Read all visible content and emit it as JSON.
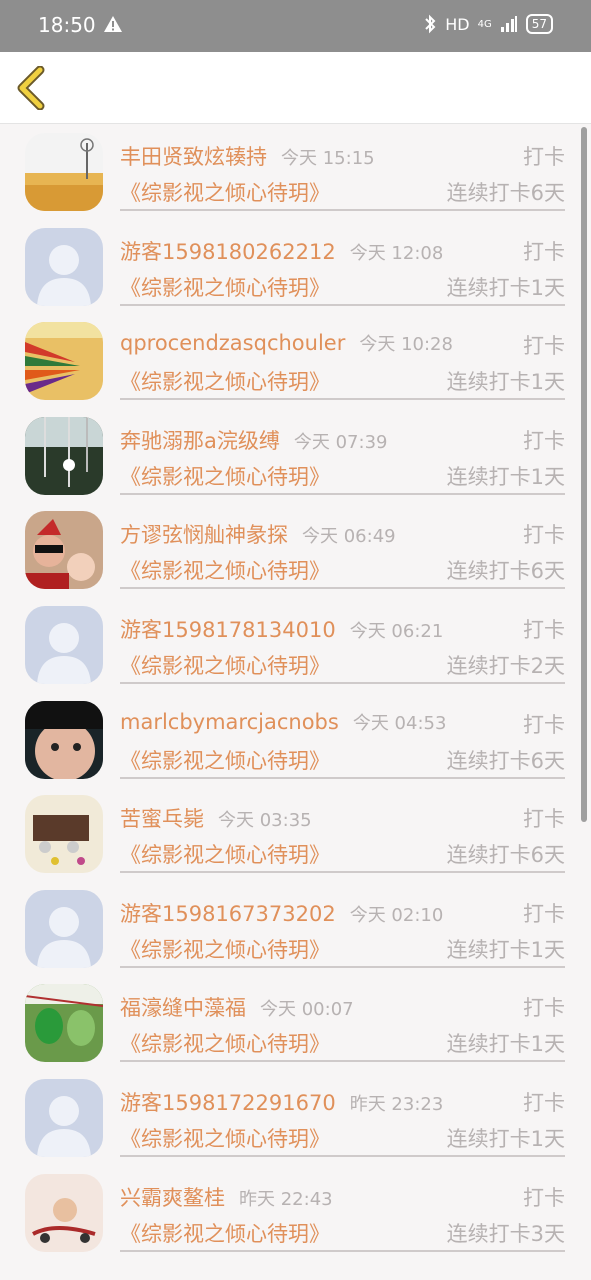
{
  "status_bar": {
    "time": "18:50",
    "network": "HD",
    "signal": "4G",
    "battery": "57"
  },
  "header": {
    "back_icon": "chevron-left-icon"
  },
  "list": [
    {
      "name": "丰田贤致炫辏持",
      "time": "今天 15:15",
      "action": "打卡",
      "book": "《综影视之倾心待玥》",
      "streak": "连续打卡6天",
      "avatar": "landscape"
    },
    {
      "name": "游客1598180262212",
      "time": "今天 12:08",
      "action": "打卡",
      "book": "《综影视之倾心待玥》",
      "streak": "连续打卡1天",
      "avatar": "default"
    },
    {
      "name": "qprocendzasqchouler",
      "time": "今天 10:28",
      "action": "打卡",
      "book": "《综影视之倾心待玥》",
      "streak": "连续打卡1天",
      "avatar": "pencils"
    },
    {
      "name": "奔驰溺那a浣级缚",
      "time": "今天 07:39",
      "action": "打卡",
      "book": "《综影视之倾心待玥》",
      "streak": "连续打卡1天",
      "avatar": "chimes"
    },
    {
      "name": "方谬弦悯舢神彖探",
      "time": "今天 06:49",
      "action": "打卡",
      "book": "《综影视之倾心待玥》",
      "streak": "连续打卡6天",
      "avatar": "family"
    },
    {
      "name": "游客1598178134010",
      "time": "今天 06:21",
      "action": "打卡",
      "book": "《综影视之倾心待玥》",
      "streak": "连续打卡2天",
      "avatar": "default"
    },
    {
      "name": "marlcbymarcjacnobs",
      "time": "今天 04:53",
      "action": "打卡",
      "book": "《综影视之倾心待玥》",
      "streak": "连续打卡6天",
      "avatar": "face"
    },
    {
      "name": "苦蜜乓毙",
      "time": "今天 03:35",
      "action": "打卡",
      "book": "《综影视之倾心待玥》",
      "streak": "连续打卡6天",
      "avatar": "truck"
    },
    {
      "name": "游客1598167373202",
      "time": "今天 02:10",
      "action": "打卡",
      "book": "《综影视之倾心待玥》",
      "streak": "连续打卡1天",
      "avatar": "default"
    },
    {
      "name": "福濠缝中藻福",
      "time": "今天 00:07",
      "action": "打卡",
      "book": "《综影视之倾心待玥》",
      "streak": "连续打卡1天",
      "avatar": "lanterns"
    },
    {
      "name": "游客1598172291670",
      "time": "昨天 23:23",
      "action": "打卡",
      "book": "《综影视之倾心待玥》",
      "streak": "连续打卡1天",
      "avatar": "default"
    },
    {
      "name": "兴霸爽鳌桂",
      "time": "昨天 22:43",
      "action": "打卡",
      "book": "《综影视之倾心待玥》",
      "streak": "连续打卡3天",
      "avatar": "cartoon"
    }
  ],
  "colors": {
    "accent": "#e0905a",
    "muted": "#b7b2b2",
    "status_bar": "#8e8e8e"
  }
}
